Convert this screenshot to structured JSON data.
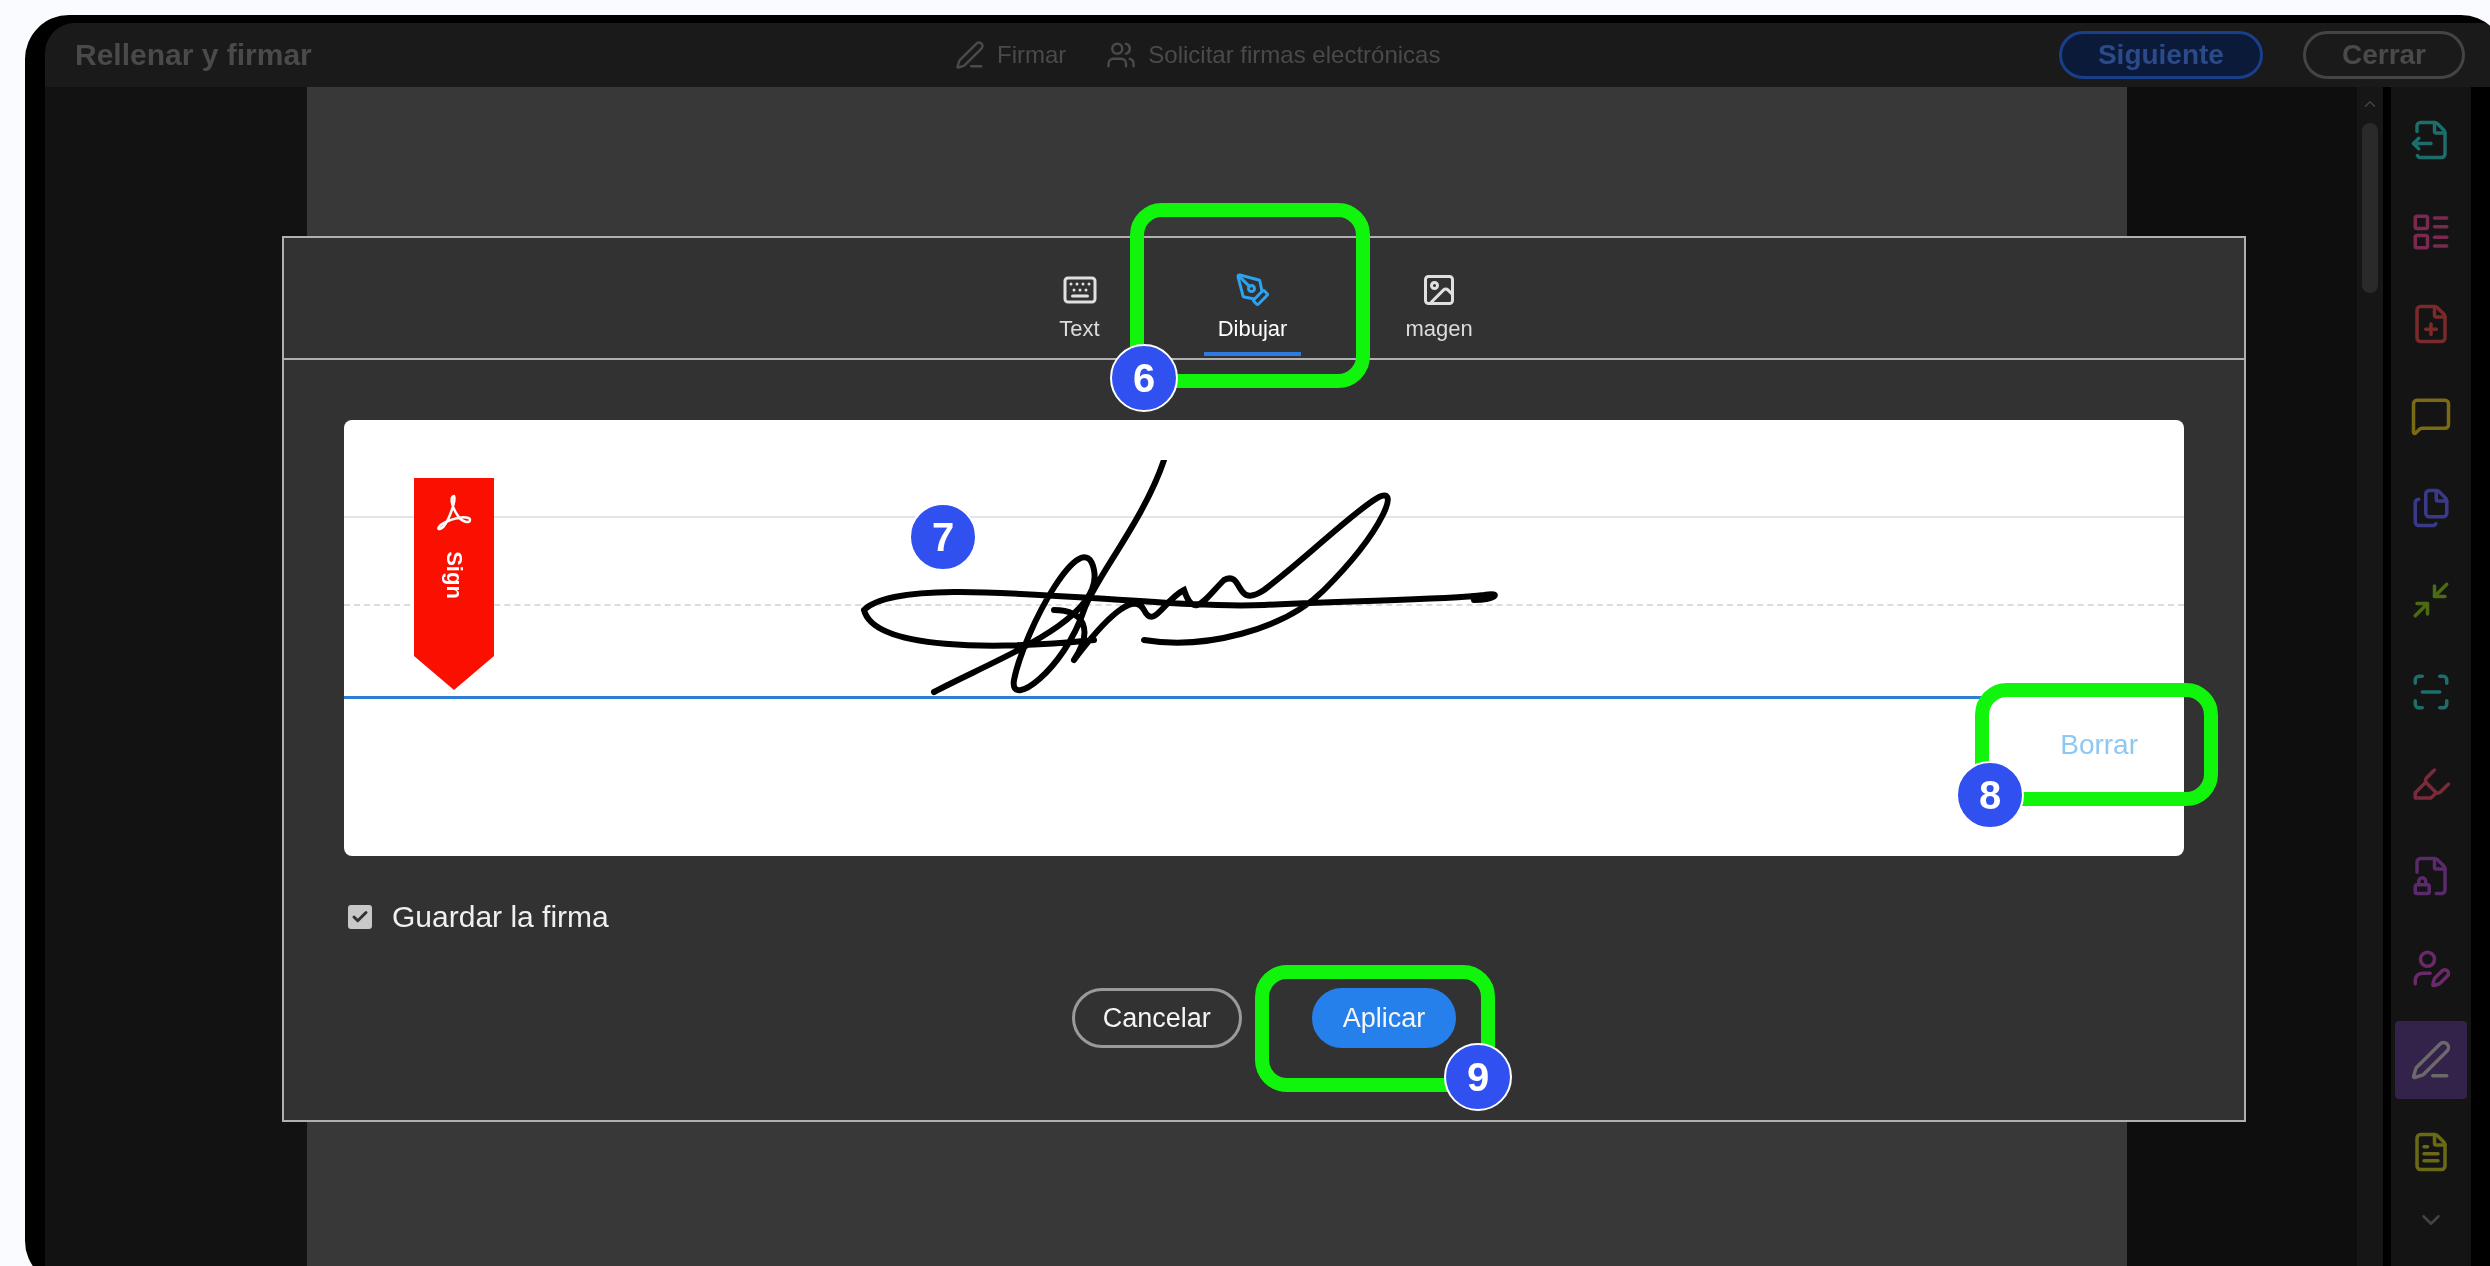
{
  "app_bar": {
    "title": "Rellenar y firmar",
    "actions": [
      {
        "label": "Firmar",
        "kind": "sign"
      },
      {
        "label": "Solicitar firmas electrónicas",
        "kind": "request"
      }
    ],
    "buttons": [
      {
        "label": "Siguiente",
        "kind": "primary"
      },
      {
        "label": "Cerrar",
        "kind": "secondary"
      }
    ]
  },
  "sidebar": {
    "tools": [
      {
        "kind": "export",
        "selected": false
      },
      {
        "kind": "organize",
        "selected": false
      },
      {
        "kind": "create",
        "selected": false
      },
      {
        "kind": "comment",
        "selected": false
      },
      {
        "kind": "combine",
        "selected": false
      },
      {
        "kind": "compress",
        "selected": false
      },
      {
        "kind": "scan",
        "selected": false
      },
      {
        "kind": "highlight",
        "selected": false
      },
      {
        "kind": "protect",
        "selected": false
      },
      {
        "kind": "request",
        "selected": false
      },
      {
        "kind": "sign",
        "selected": true
      },
      {
        "kind": "note",
        "selected": false
      }
    ]
  },
  "dialog": {
    "tabs": [
      {
        "label": "Text",
        "kind": "keyboard",
        "selected": false
      },
      {
        "label": "Dibujar",
        "kind": "pen",
        "selected": true
      },
      {
        "label": "magen",
        "kind": "image",
        "selected": false
      }
    ],
    "badge": "Sign",
    "clear_link": "Borrar",
    "save_signature": {
      "label": "Guardar la firma",
      "checked": true
    },
    "buttons": [
      {
        "label": "Cancelar",
        "kind": "secondary"
      },
      {
        "label": "Aplicar",
        "kind": "primary"
      }
    ]
  },
  "annotations": [
    {
      "number": "6"
    },
    {
      "number": "7"
    },
    {
      "number": "8"
    },
    {
      "number": "9"
    }
  ]
}
